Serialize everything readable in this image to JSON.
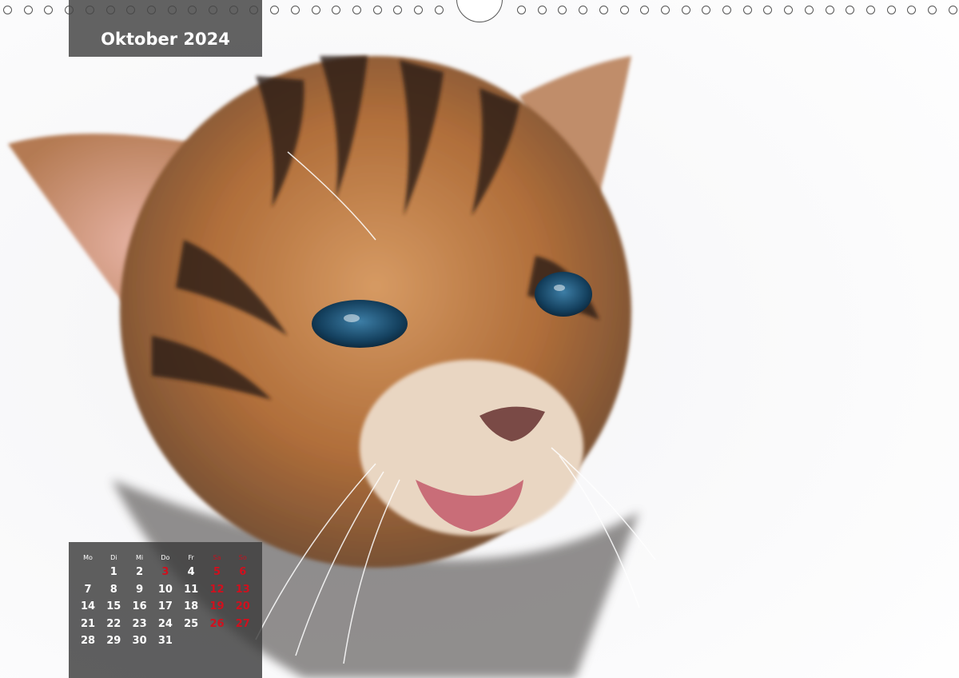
{
  "calendar_page": {
    "month_title": "Oktober 2024",
    "weekdays": [
      {
        "label": "Mo",
        "weekend": false
      },
      {
        "label": "Di",
        "weekend": false
      },
      {
        "label": "Mi",
        "weekend": false
      },
      {
        "label": "Do",
        "weekend": false
      },
      {
        "label": "Fr",
        "weekend": false
      },
      {
        "label": "Sa",
        "weekend": true
      },
      {
        "label": "So",
        "weekend": true
      }
    ],
    "weeks": [
      [
        "",
        "1",
        "2",
        "3",
        "4",
        "5",
        "6"
      ],
      [
        "7",
        "8",
        "9",
        "10",
        "11",
        "12",
        "13"
      ],
      [
        "14",
        "15",
        "16",
        "17",
        "18",
        "19",
        "20"
      ],
      [
        "21",
        "22",
        "23",
        "24",
        "25",
        "26",
        "27"
      ],
      [
        "28",
        "29",
        "30",
        "31",
        "",
        "",
        ""
      ]
    ],
    "holidays": [
      "3"
    ],
    "colors": {
      "box_background": "#464646",
      "text": "#ffffff",
      "weekend_holiday": "#c8101e"
    },
    "photo": {
      "subject": "tabby-kitten-photo"
    }
  }
}
